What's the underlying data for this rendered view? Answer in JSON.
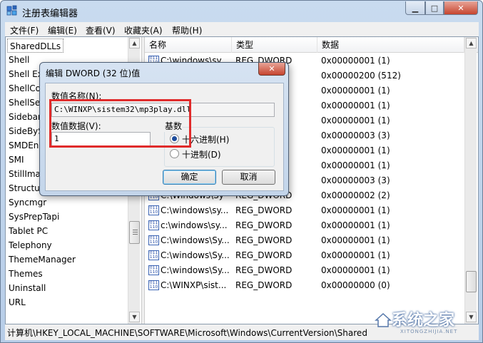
{
  "window": {
    "title": "注册表编辑器",
    "min_symbol": "▁",
    "max_symbol": "□",
    "close_symbol": "✕"
  },
  "menu": [
    "文件(F)",
    "编辑(E)",
    "查看(V)",
    "收藏夹(A)",
    "帮助(H)"
  ],
  "tree": {
    "items": [
      "SharedDLLs",
      "Shell",
      "Shell Ex",
      "ShellCo",
      "ShellSer",
      "Sidebar",
      "SideBySi",
      "SMDEn",
      "SMI",
      "StillImag",
      "Structur",
      "Syncmgr",
      "SysPrepTapi",
      "Tablet PC",
      "Telephony",
      "ThemeManager",
      "Themes",
      "Uninstall",
      "URL"
    ],
    "selected_index": 0
  },
  "list": {
    "columns": [
      "名称",
      "类型",
      "数据"
    ],
    "rows": [
      {
        "name": "C:\\windows\\sy",
        "type": "REG_DWORD",
        "data": "0x00000001 (1)"
      },
      {
        "name": "",
        "type": "",
        "data": "0x00000200 (512)"
      },
      {
        "name": "",
        "type": "",
        "data": "0x00000001 (1)"
      },
      {
        "name": "",
        "type": "",
        "data": "0x00000001 (1)"
      },
      {
        "name": "",
        "type": "",
        "data": "0x00000001 (1)"
      },
      {
        "name": "",
        "type": "",
        "data": "0x00000003 (3)"
      },
      {
        "name": "",
        "type": "",
        "data": "0x00000001 (1)"
      },
      {
        "name": "",
        "type": "",
        "data": "0x00000001 (1)"
      },
      {
        "name": "",
        "type": "",
        "data": "0x00000003 (3)"
      },
      {
        "name": "C:\\Windows\\Sy",
        "type": "REG_DWORD",
        "data": "0x00000002 (2)"
      },
      {
        "name": "C:\\windows\\sy...",
        "type": "REG_DWORD",
        "data": "0x00000001 (1)"
      },
      {
        "name": "c:\\windows\\sy...",
        "type": "REG_DWORD",
        "data": "0x00000001 (1)"
      },
      {
        "name": "C:\\windows\\Sy...",
        "type": "REG_DWORD",
        "data": "0x00000001 (1)"
      },
      {
        "name": "C:\\windows\\Sy...",
        "type": "REG_DWORD",
        "data": "0x00000001 (1)"
      },
      {
        "name": "C:\\windows\\Sy...",
        "type": "REG_DWORD",
        "data": "0x00000001 (1)"
      },
      {
        "name": "C:\\WINXP\\sist...",
        "type": "REG_DWORD",
        "data": "0x00000000 (0)"
      }
    ]
  },
  "status": {
    "path": "计算机\\HKEY_LOCAL_MACHINE\\SOFTWARE\\Microsoft\\Windows\\CurrentVersion\\Shared"
  },
  "watermark": {
    "text": "系统之家",
    "sub": "XITONGZHIJIA.NET"
  },
  "dialog": {
    "title": "编辑 DWORD (32 位)值",
    "close_symbol": "✕",
    "name_label": "数值名称(N):",
    "name_value": "C:\\WINXP\\sistem32\\mp3play.dll",
    "data_label": "数值数据(V):",
    "data_value": "1",
    "base_label": "基数",
    "hex_label": "十六进制(H)",
    "dec_label": "十进制(D)",
    "selected_base": "hex",
    "ok_label": "确定",
    "cancel_label": "取消"
  },
  "colors": {
    "highlight": "#e02b2b",
    "accent": "#3c7fb1"
  }
}
